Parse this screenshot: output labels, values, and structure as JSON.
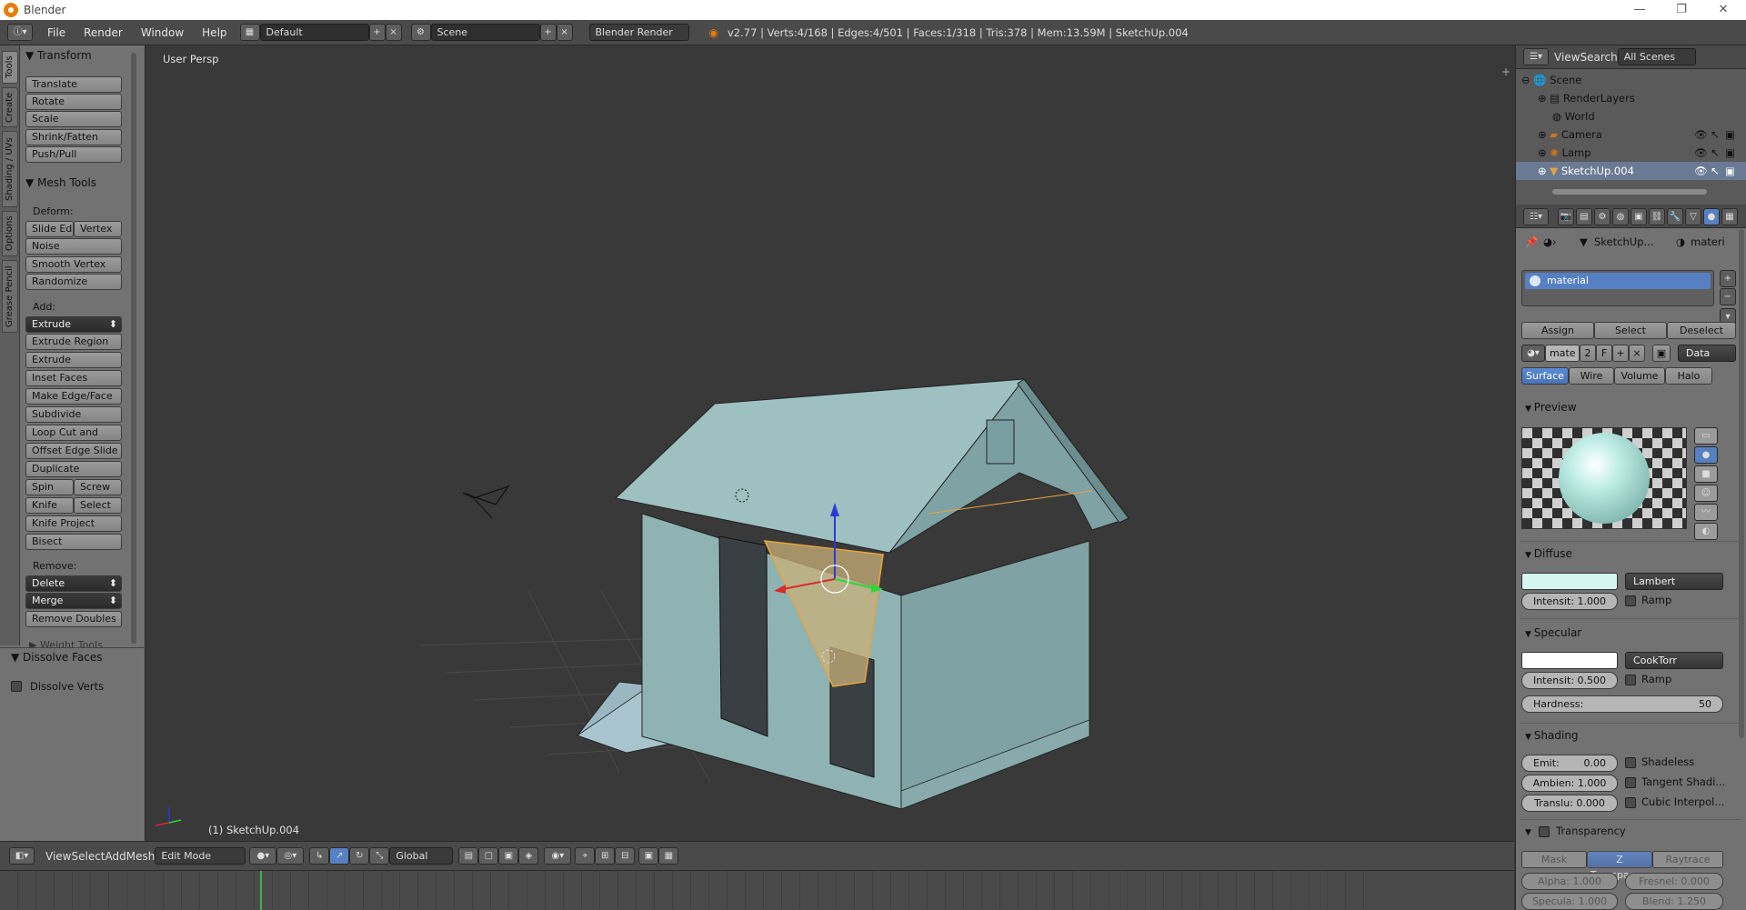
{
  "window": {
    "title": "Blender"
  },
  "topbar": {
    "menus": [
      "File",
      "Render",
      "Window",
      "Help"
    ],
    "layout": "Default",
    "scene": "Scene",
    "engine": "Blender Render",
    "stats": "v2.77 | Verts:4/168 | Edges:4/501 | Faces:1/318 | Tris:378 | Mem:13.59M | SketchUp.004"
  },
  "tool_tabs": [
    "Tools",
    "Create",
    "Shading / UVs",
    "Options",
    "Grease Pencil"
  ],
  "toolshelf": {
    "transform_title": "Transform",
    "transform": [
      "Translate",
      "Rotate",
      "Scale",
      "Shrink/Fatten",
      "Push/Pull"
    ],
    "mesh_tools_title": "Mesh Tools",
    "deform_label": "Deform:",
    "deform": {
      "slide_edge": "Slide Ed",
      "vertex": "Vertex",
      "noise": "Noise",
      "smooth": "Smooth Vertex",
      "randomize": "Randomize"
    },
    "add_label": "Add:",
    "extrude": "Extrude",
    "add": [
      "Extrude Region",
      "Extrude Individual",
      "Inset Faces",
      "Make Edge/Face",
      "Subdivide",
      "Loop Cut and Slide",
      "Offset Edge Slide",
      "Duplicate"
    ],
    "spin": "Spin",
    "screw": "Screw",
    "knife": "Knife",
    "select": "Select",
    "knife_project": "Knife Project",
    "bisect": "Bisect",
    "remove_label": "Remove:",
    "delete": "Delete",
    "merge": "Merge",
    "remove_doubles": "Remove Doubles",
    "weight_tools": "Weight Tools",
    "dissolve_title": "Dissolve Faces",
    "dissolve_verts": "Dissolve Verts"
  },
  "viewport": {
    "view_label": "User Persp",
    "object_label": "(1) SketchUp.004",
    "colors": {
      "wall": "#8fb3b3",
      "roof": "#9ec0c0",
      "selected": "#c9b07a"
    }
  },
  "bottom_bar": {
    "menus": [
      "View",
      "Select",
      "Add",
      "Mesh"
    ],
    "mode": "Edit Mode",
    "orientation": "Global"
  },
  "outliner": {
    "menus": [
      "View",
      "Search"
    ],
    "filter": "All Scenes",
    "items": [
      "Scene",
      "RenderLayers",
      "World",
      "Camera",
      "Lamp",
      "SketchUp.004"
    ]
  },
  "properties": {
    "breadcrumb_object": "SketchUp...",
    "breadcrumb_material": "materi",
    "slot_name": "material",
    "assign": "Assign",
    "select": "Select",
    "deselect": "Deselect",
    "mat_name": "mate",
    "users": "2",
    "fake": "F",
    "link": "Data",
    "tabs": [
      "Surface",
      "Wire",
      "Volume",
      "Halo"
    ],
    "preview_title": "Preview",
    "diffuse_title": "Diffuse",
    "diffuse_shader": "Lambert",
    "diffuse_intensity": "Intensit: 1.000",
    "ramp": "Ramp",
    "specular_title": "Specular",
    "specular_shader": "CookTorr",
    "specular_intensity": "Intensit: 0.500",
    "hardness_label": "Hardness:",
    "hardness_value": "50",
    "shading_title": "Shading",
    "emit_label": "Emit:",
    "emit_value": "0.00",
    "ambient": "Ambien: 1.000",
    "translucency": "Translu: 0.000",
    "shadeless": "Shadeless",
    "tangent": "Tangent Shadi...",
    "cubic": "Cubic Interpol...",
    "transparency_title": "Transparency",
    "trans_modes": [
      "Mask",
      "Z Transpare...",
      "Raytrace"
    ],
    "alpha": "Alpha: 1.000",
    "fresnel": "Fresnel: 0.000",
    "specular_alpha": "Specula: 1.000",
    "blend": "Blend: 1.250",
    "colors": {
      "diffuse": "#d6f5f0",
      "specular": "#ffffff",
      "accent": "#5680c2"
    }
  }
}
